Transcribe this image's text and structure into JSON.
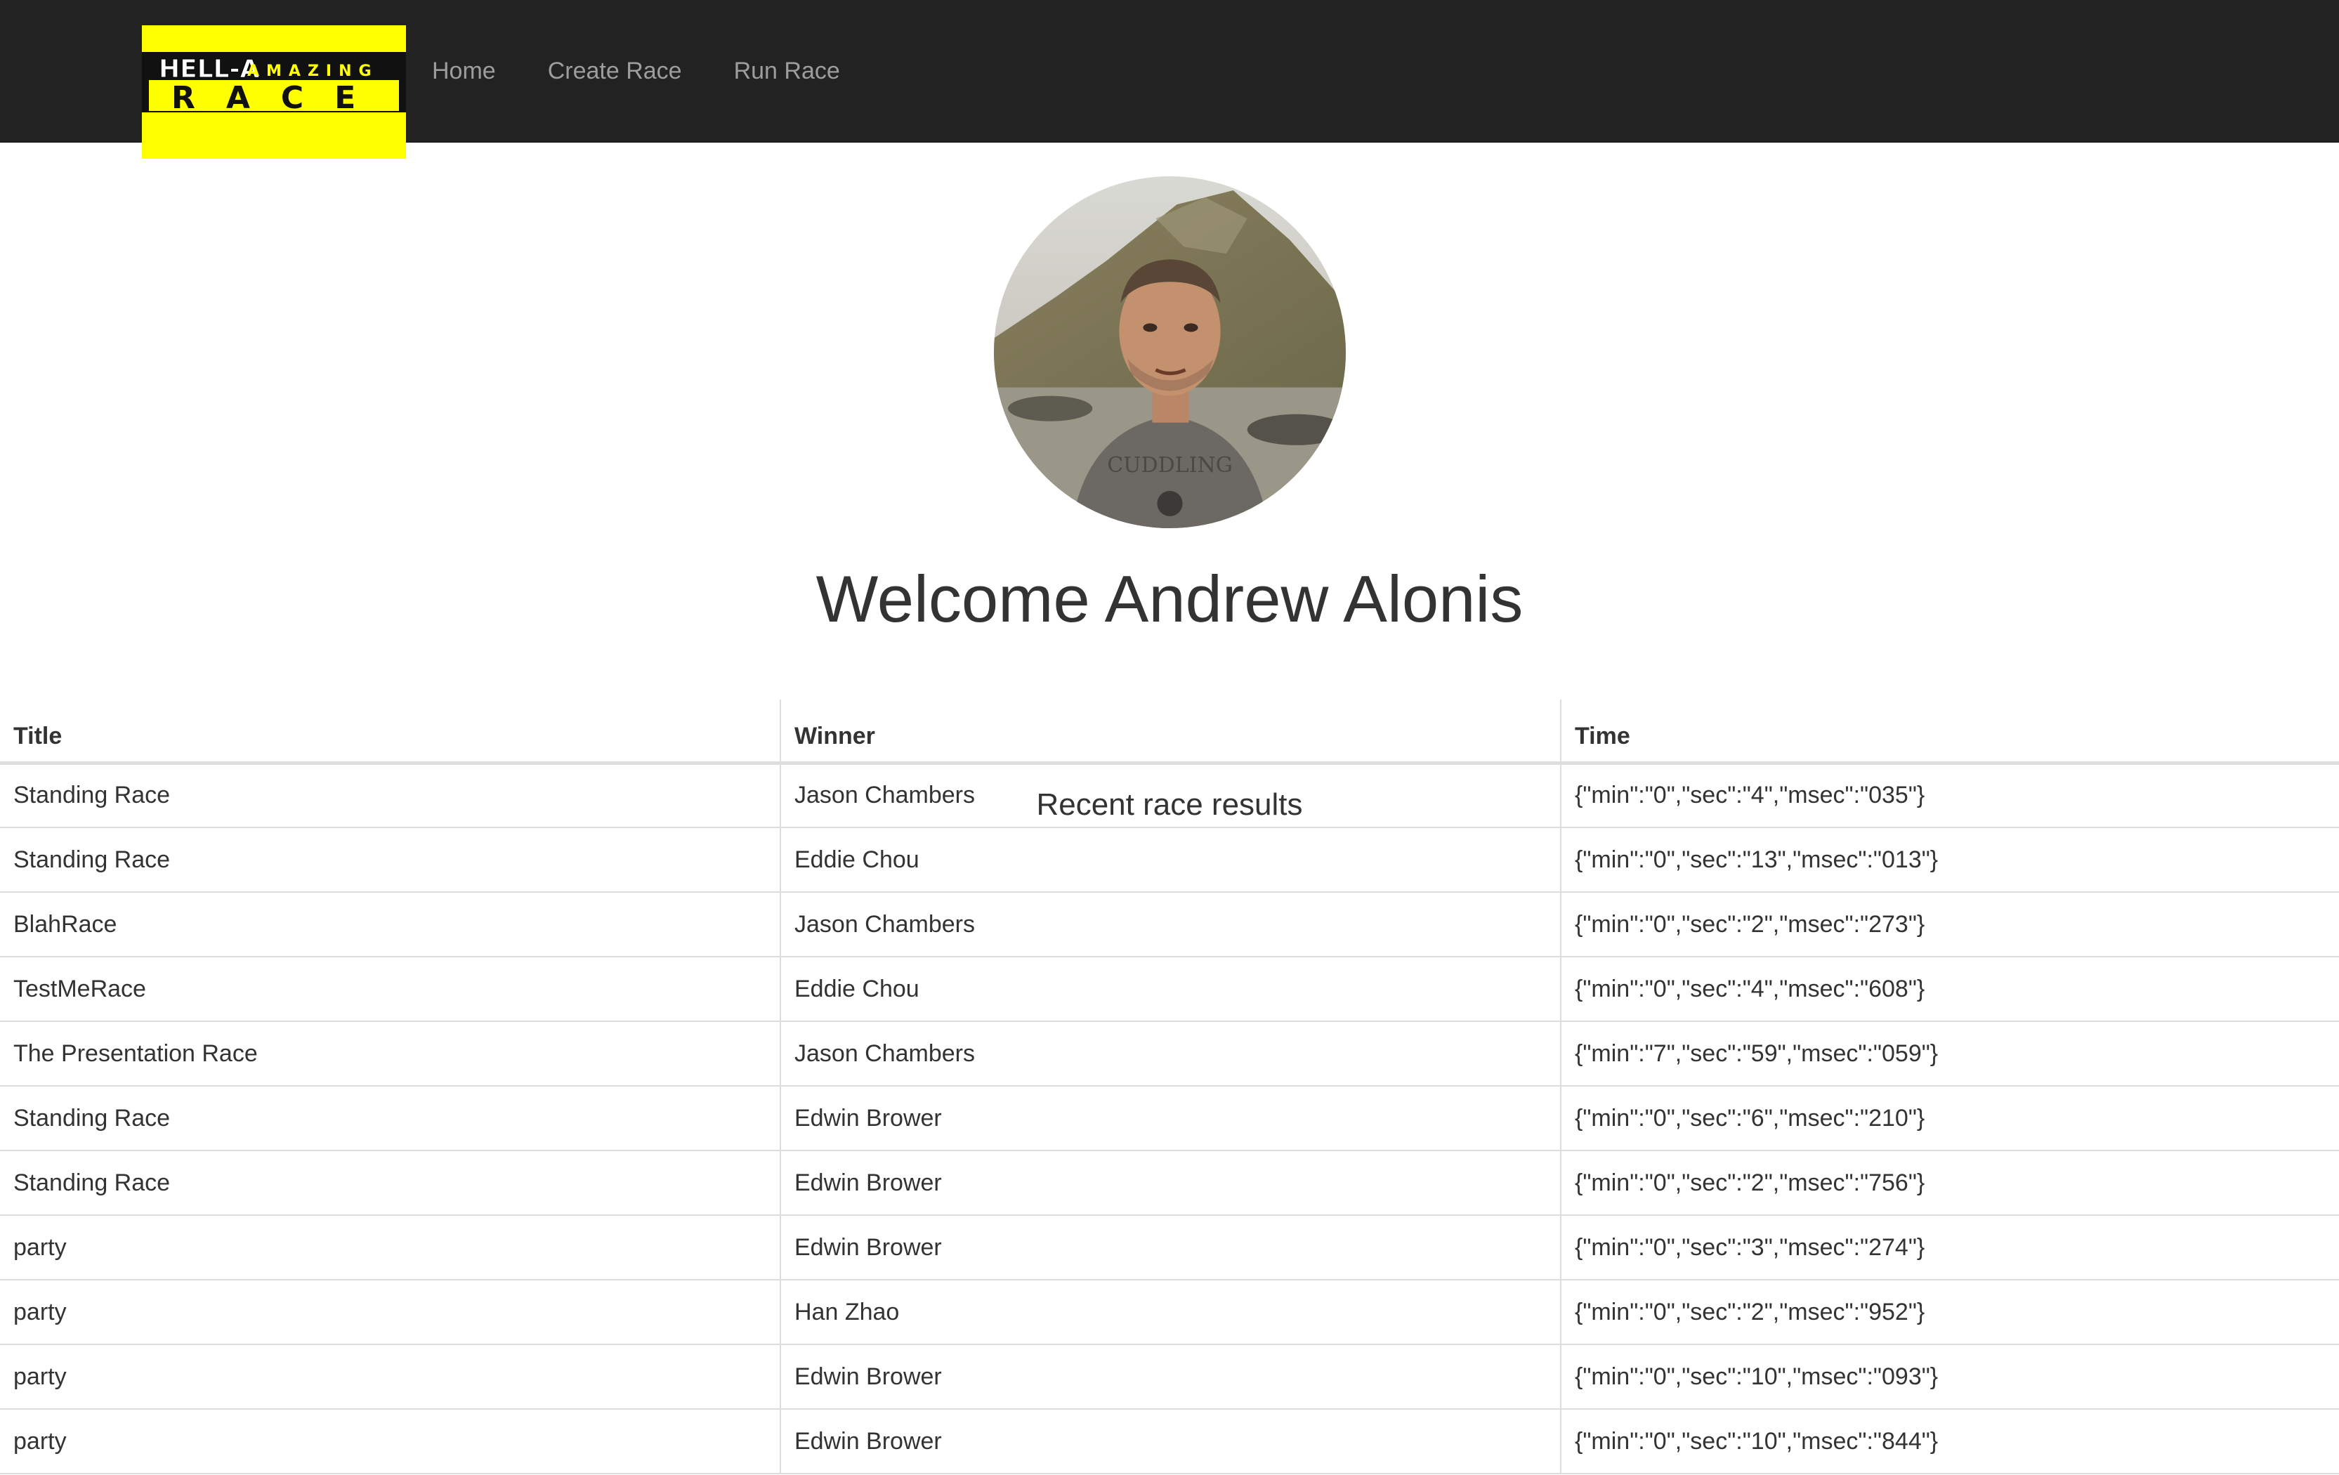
{
  "navbar": {
    "brand": {
      "line1_bold": "HELL-A",
      "line1_rest": "AMAZING",
      "line2": "RACE"
    },
    "links": [
      {
        "label": "Home"
      },
      {
        "label": "Create Race"
      },
      {
        "label": "Run Race"
      }
    ]
  },
  "profile": {
    "welcome": "Welcome Andrew Alonis",
    "subtitle": "Recent race results",
    "shirt_text": "CUDDLING"
  },
  "table": {
    "headers": [
      "Title",
      "Winner",
      "Time"
    ],
    "rows": [
      [
        "Standing Race",
        "Jason Chambers",
        "{\"min\":\"0\",\"sec\":\"4\",\"msec\":\"035\"}"
      ],
      [
        "Standing Race",
        "Eddie Chou",
        "{\"min\":\"0\",\"sec\":\"13\",\"msec\":\"013\"}"
      ],
      [
        "BlahRace",
        "Jason Chambers",
        "{\"min\":\"0\",\"sec\":\"2\",\"msec\":\"273\"}"
      ],
      [
        "TestMeRace",
        "Eddie Chou",
        "{\"min\":\"0\",\"sec\":\"4\",\"msec\":\"608\"}"
      ],
      [
        "The Presentation Race",
        "Jason Chambers",
        "{\"min\":\"7\",\"sec\":\"59\",\"msec\":\"059\"}"
      ],
      [
        "Standing Race",
        "Edwin Brower",
        "{\"min\":\"0\",\"sec\":\"6\",\"msec\":\"210\"}"
      ],
      [
        "Standing Race",
        "Edwin Brower",
        "{\"min\":\"0\",\"sec\":\"2\",\"msec\":\"756\"}"
      ],
      [
        "party",
        "Edwin Brower",
        "{\"min\":\"0\",\"sec\":\"3\",\"msec\":\"274\"}"
      ],
      [
        "party",
        "Han Zhao",
        "{\"min\":\"0\",\"sec\":\"2\",\"msec\":\"952\"}"
      ],
      [
        "party",
        "Edwin Brower",
        "{\"min\":\"0\",\"sec\":\"10\",\"msec\":\"093\"}"
      ],
      [
        "party",
        "Edwin Brower",
        "{\"min\":\"0\",\"sec\":\"10\",\"msec\":\"844\"}"
      ]
    ]
  },
  "colors": {
    "navbar_bg": "#222222",
    "nav_link": "#9d9d9d",
    "brand_bg": "#ffff00",
    "text": "#333333",
    "table_border": "#dddddd"
  }
}
